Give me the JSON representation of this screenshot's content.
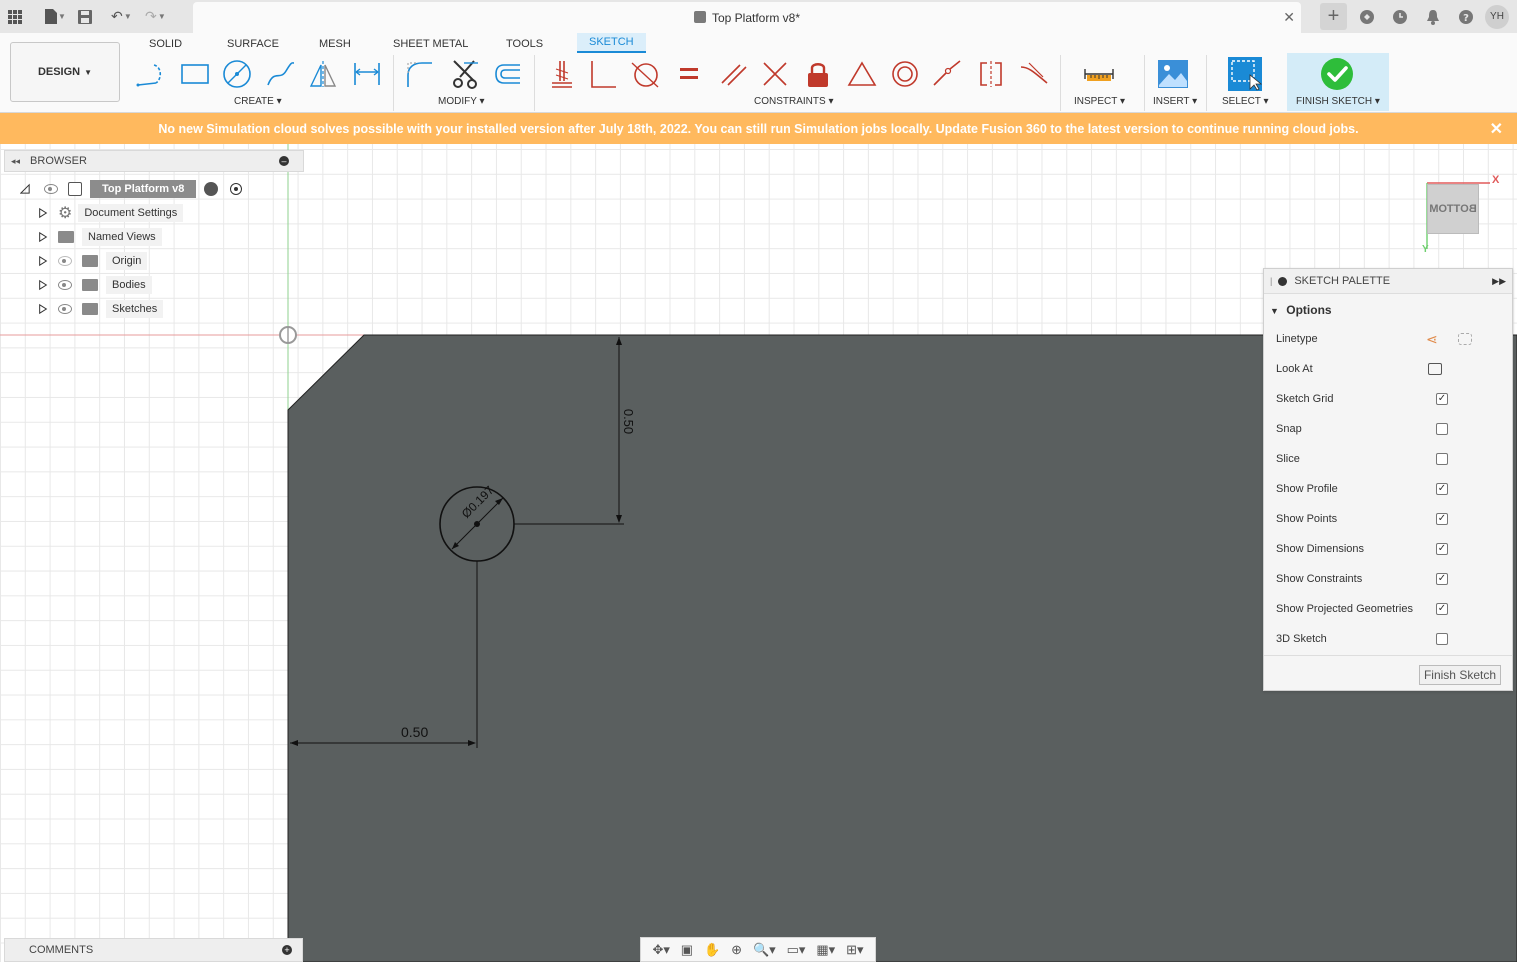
{
  "title_bar": {
    "document_title": "Top Platform v8*",
    "user_initials": "YH",
    "icons": [
      "grid-icon",
      "file-icon",
      "save-icon",
      "undo-icon",
      "redo-icon",
      "close-icon",
      "plus-icon",
      "job-status-icon",
      "clock-icon",
      "bell-icon",
      "help-icon"
    ]
  },
  "toolbar": {
    "workspace": "DESIGN",
    "tabs": [
      {
        "label": "SOLID",
        "active": false
      },
      {
        "label": "SURFACE",
        "active": false
      },
      {
        "label": "MESH",
        "active": false
      },
      {
        "label": "SHEET METAL",
        "active": false
      },
      {
        "label": "TOOLS",
        "active": false
      },
      {
        "label": "SKETCH",
        "active": true
      }
    ],
    "groups": {
      "create": "CREATE",
      "modify": "MODIFY",
      "constraints": "CONSTRAINTS",
      "inspect": "INSPECT",
      "insert": "INSERT",
      "select": "SELECT",
      "finish": "FINISH SKETCH"
    },
    "accent_color": "#1a8ad6",
    "constraint_color": "#c0392b"
  },
  "banner": {
    "message": "No new Simulation cloud solves possible with your installed version after July 18th, 2022. You can still run Simulation jobs locally. Update Fusion 360 to the latest version to continue running cloud jobs.",
    "color": "#ffb95e"
  },
  "browser": {
    "header": "BROWSER",
    "root": "Top Platform v8",
    "items": [
      {
        "label": "Document Settings",
        "icon": "gear-icon",
        "visible": null
      },
      {
        "label": "Named Views",
        "icon": "folder-icon",
        "visible": null
      },
      {
        "label": "Origin",
        "icon": "folder-icon",
        "visible": false
      },
      {
        "label": "Bodies",
        "icon": "folder-icon",
        "visible": true
      },
      {
        "label": "Sketches",
        "icon": "folder-icon",
        "visible": true
      }
    ]
  },
  "comments": {
    "header": "COMMENTS"
  },
  "viewcube": {
    "face": "BOTTOM",
    "x_axis": "X",
    "y_axis": "Y"
  },
  "sketch": {
    "dimension_vertical": "0.50",
    "dimension_horizontal": "0.50",
    "dimension_diameter": "Ø0.197",
    "profile_color": "#5a5f5f"
  },
  "palette": {
    "header": "SKETCH PALETTE",
    "section": "Options",
    "rows": [
      {
        "label": "Linetype",
        "type": "icons"
      },
      {
        "label": "Look At",
        "type": "icon"
      },
      {
        "label": "Sketch Grid",
        "type": "checkbox",
        "checked": true
      },
      {
        "label": "Snap",
        "type": "checkbox",
        "checked": false
      },
      {
        "label": "Slice",
        "type": "checkbox",
        "checked": false
      },
      {
        "label": "Show Profile",
        "type": "checkbox",
        "checked": true
      },
      {
        "label": "Show Points",
        "type": "checkbox",
        "checked": true
      },
      {
        "label": "Show Dimensions",
        "type": "checkbox",
        "checked": true
      },
      {
        "label": "Show Constraints",
        "type": "checkbox",
        "checked": true
      },
      {
        "label": "Show Projected Geometries",
        "type": "checkbox",
        "checked": true
      },
      {
        "label": "3D Sketch",
        "type": "checkbox",
        "checked": false
      }
    ],
    "finish_button": "Finish Sketch"
  }
}
